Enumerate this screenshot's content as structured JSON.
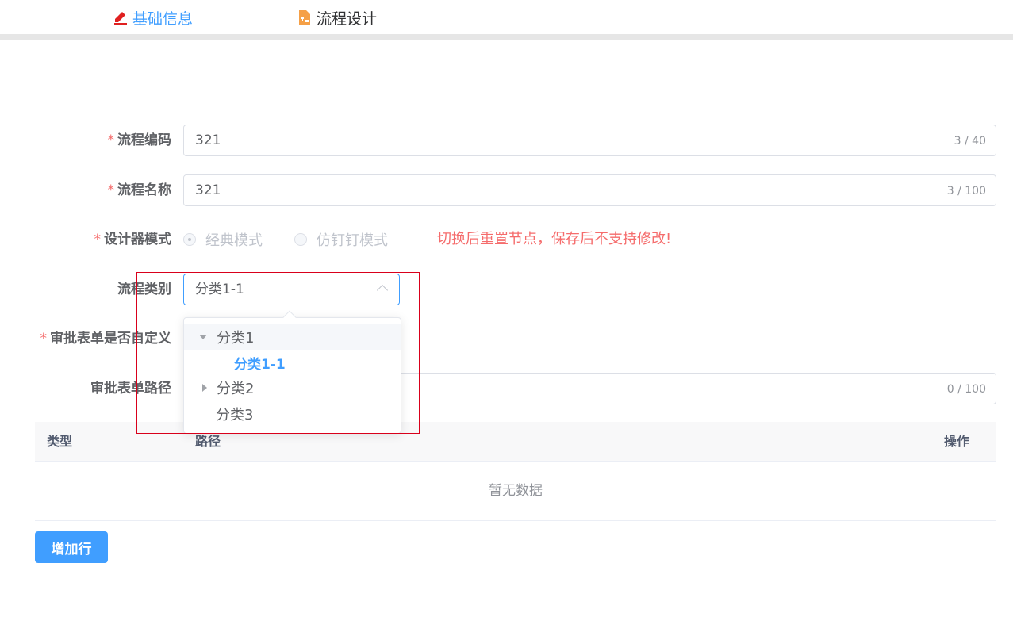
{
  "tabs": [
    {
      "label": "基础信息",
      "icon": "edit-icon",
      "color": "#409eff"
    },
    {
      "label": "流程设计",
      "icon": "flow-document-icon",
      "color": "#303133"
    }
  ],
  "form": {
    "code": {
      "label": "流程编码",
      "value": "321",
      "count": "3 / 40"
    },
    "name": {
      "label": "流程名称",
      "value": "321",
      "count": "3 / 100"
    },
    "mode": {
      "label": "设计器模式",
      "options": [
        "经典模式",
        "仿钉钉模式"
      ],
      "selected": "经典模式",
      "warning": "切换后重置节点，保存后不支持修改!"
    },
    "category": {
      "label": "流程类别",
      "value": "分类1-1"
    },
    "custom_form": {
      "label": "审批表单是否自定义"
    },
    "form_path": {
      "label": "审批表单路径",
      "count": "0 / 100"
    }
  },
  "category_tree": [
    {
      "label": "分类1",
      "expanded": true,
      "children": [
        {
          "label": "分类1-1",
          "selected": true
        }
      ]
    },
    {
      "label": "分类2",
      "expanded": false
    },
    {
      "label": "分类3"
    }
  ],
  "table": {
    "columns": [
      "类型",
      "路径",
      "操作"
    ],
    "empty_text": "暂无数据"
  },
  "add_row_button": "增加行",
  "colors": {
    "primary": "#409eff",
    "danger": "#f56c6c",
    "required": "#f56c6c"
  }
}
